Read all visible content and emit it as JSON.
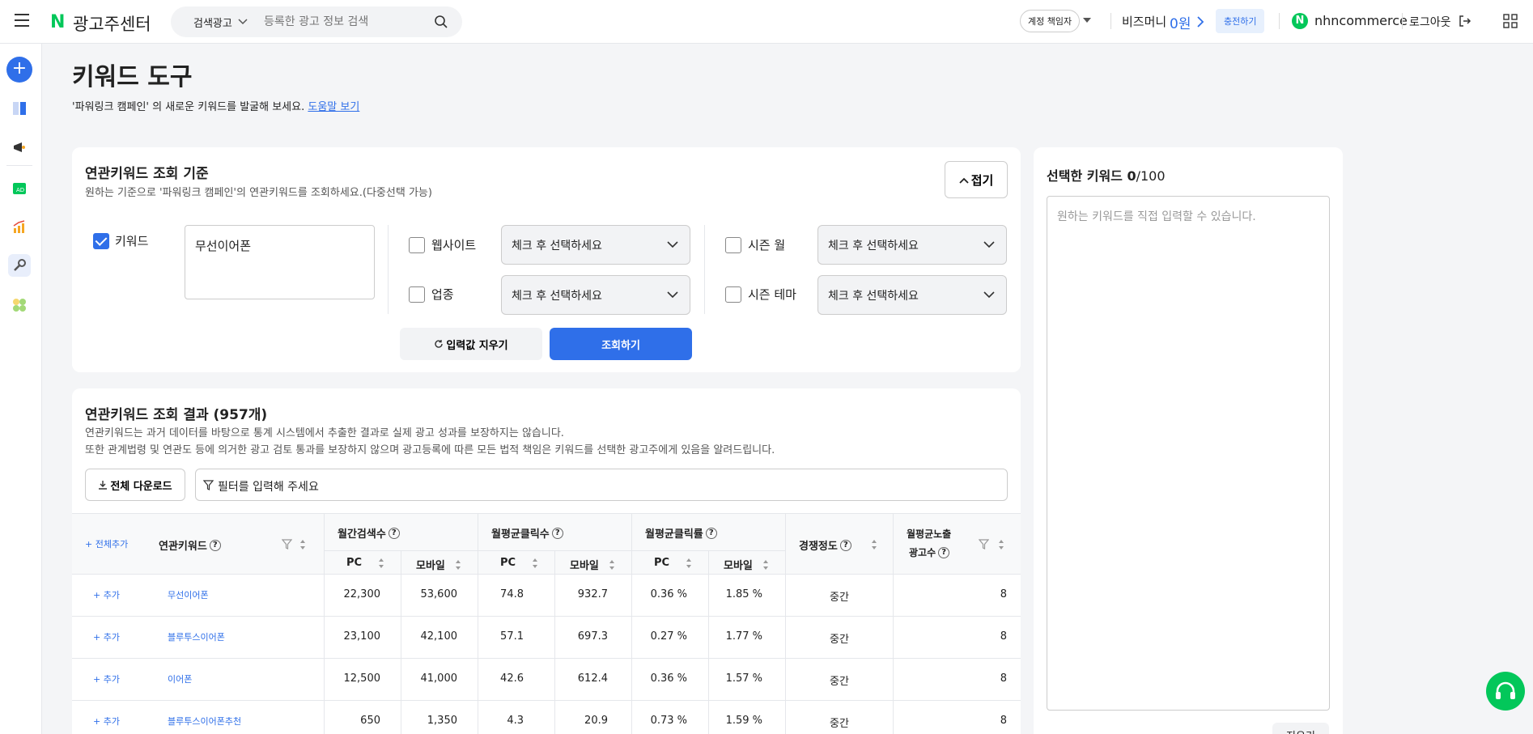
{
  "header": {
    "logo_n": "N",
    "logo_text": "광고주센터",
    "search_scope": "검색광고",
    "search_placeholder": "등록한 광고 정보 검색",
    "role_badge": "계정 책임자",
    "biz_label": "비즈머니",
    "biz_amount": "0원",
    "charge_label": "충전하기",
    "account_badge": "N",
    "account_name": "nhncommerce",
    "logout_label": "로그아웃"
  },
  "page": {
    "title": "키워드 도구",
    "desc_prefix": "'파워링크 캠페인' 의 새로운 키워드를 발굴해 보세요.",
    "help_link": "도움말 보기"
  },
  "criteria": {
    "title": "연관키워드 조회 기준",
    "subtitle": "원하는 기준으로 '파워링크 캠페인'의 연관키워드를 조회하세요.(다중선택 가능)",
    "fold_label": "접기",
    "keyword_label": "키워드",
    "keyword_value": "무선이어폰",
    "website_label": "웹사이트",
    "industry_label": "업종",
    "season_month_label": "시즌 월",
    "season_theme_label": "시즌 테마",
    "select_placeholder": "체크 후 선택하세요",
    "clear_label": "입력값 지우기",
    "search_label": "조회하기"
  },
  "results": {
    "title": "연관키워드 조회 결과 (957개)",
    "note1": "연관키워드는 과거 데이터를 바탕으로 통계 시스템에서 추출한 결과로 실제 광고 성과를 보장하지는 않습니다.",
    "note2": "또한 관계법령 및 연관도 등에 의거한 광고 검토 통과를 보장하지 않으며 광고등록에 따른 모든 법적 책임은 키워드를 선택한 광고주에게 있음을 알려드립니다.",
    "download_label": "전체 다운로드",
    "filter_placeholder": "필터를 입력해 주세요",
    "headers": {
      "add_all": "+ 전체추가",
      "keyword": "연관키워드",
      "monthly_search": "월간검색수",
      "avg_clicks": "월평균클릭수",
      "avg_ctr": "월평균클릭률",
      "competition": "경쟁정도",
      "avg_impressions_line1": "월평균노출",
      "avg_impressions_line2": "광고수",
      "pc": "PC",
      "mobile": "모바일"
    },
    "add_label": "+ 추가",
    "rows": [
      {
        "keyword": "무선이어폰",
        "pc_search": "22,300",
        "mo_search": "53,600",
        "pc_clicks": "74.8",
        "mo_clicks": "932.7",
        "pc_ctr": "0.36 %",
        "mo_ctr": "1.85 %",
        "competition": "중간",
        "ads": "8"
      },
      {
        "keyword": "블루투스이어폰",
        "pc_search": "23,100",
        "mo_search": "42,100",
        "pc_clicks": "57.1",
        "mo_clicks": "697.3",
        "pc_ctr": "0.27 %",
        "mo_ctr": "1.77 %",
        "competition": "중간",
        "ads": "8"
      },
      {
        "keyword": "이어폰",
        "pc_search": "12,500",
        "mo_search": "41,000",
        "pc_clicks": "42.6",
        "mo_clicks": "612.4",
        "pc_ctr": "0.36 %",
        "mo_ctr": "1.57 %",
        "competition": "중간",
        "ads": "8"
      },
      {
        "keyword": "블루투스이어폰추천",
        "pc_search": "650",
        "mo_search": "1,350",
        "pc_clicks": "4.3",
        "mo_clicks": "20.9",
        "pc_ctr": "0.73 %",
        "mo_ctr": "1.59 %",
        "competition": "중간",
        "ads": "8"
      }
    ]
  },
  "selected": {
    "title_prefix": "선택한 키워드",
    "count": "0",
    "max": "/100",
    "placeholder": "원하는 키워드를 직접 입력할 수 있습니다.",
    "bottom_button": "지우기"
  },
  "colors": {
    "accent": "#2f6fe9",
    "brand_green": "#03c75a"
  }
}
